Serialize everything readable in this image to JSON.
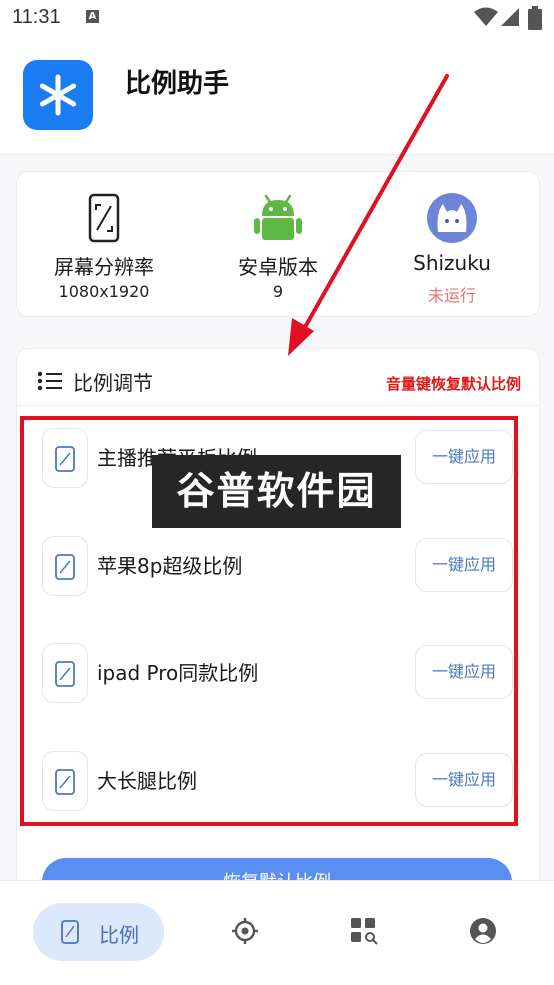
{
  "status_bar": {
    "time": "11:31",
    "notification_letter": "A"
  },
  "app": {
    "title": "比例助手"
  },
  "info": [
    {
      "label": "屏幕分辨率",
      "value": "1080x1920",
      "icon": "phone-resolution-icon"
    },
    {
      "label": "安卓版本",
      "value": "9",
      "icon": "android-icon"
    },
    {
      "label": "Shizuku",
      "value": "未运行",
      "icon": "shizuku-icon"
    }
  ],
  "ratio_section": {
    "title": "比例调节",
    "hint": "音量键恢复默认比例",
    "items": [
      {
        "name": "主播推荐平板比例",
        "button": "一键应用"
      },
      {
        "name": "苹果8p超级比例",
        "button": "一键应用"
      },
      {
        "name": "ipad Pro同款比例",
        "button": "一键应用"
      },
      {
        "name": "大长腿比例",
        "button": "一键应用"
      }
    ],
    "primary_button": "恢复默认比例"
  },
  "watermark": {
    "text": "谷普软件园"
  },
  "nav": {
    "active_label": "比例"
  },
  "colors": {
    "accent": "#1a7cf2",
    "highlight": "#e11020",
    "hint_red": "#e01a1a",
    "link_blue": "#4a78c2"
  }
}
